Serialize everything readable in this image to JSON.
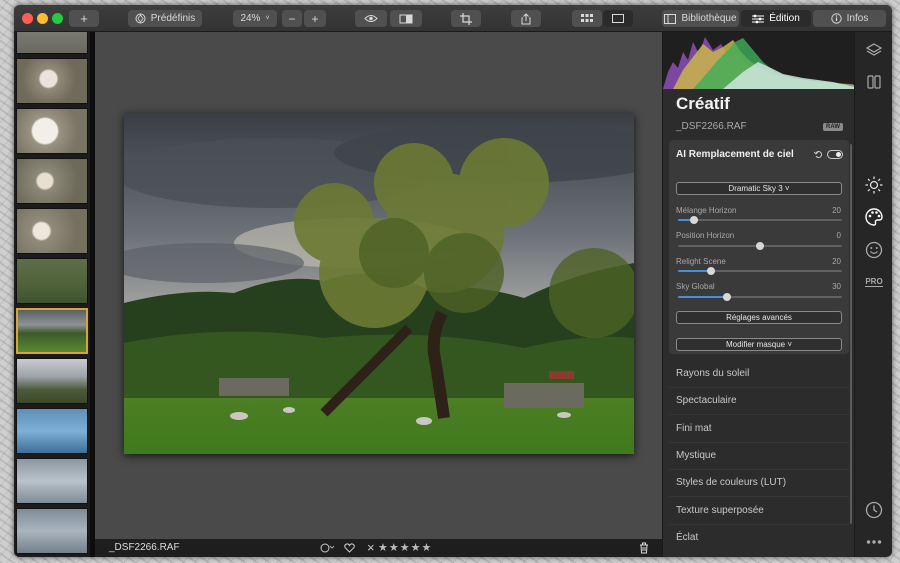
{
  "toolbar": {
    "add_label": "+",
    "presets_label": "Prédéfinis",
    "zoom_value": "24%",
    "zoom_minus": "−",
    "zoom_plus": "+",
    "library_label": "Bibliothèque",
    "edit_label": "Édition",
    "info_label": "Infos"
  },
  "panel": {
    "title": "Créatif",
    "filename": "_DSF2266.RAF",
    "raw_badge": "RAW",
    "card": {
      "title": "AI Remplacement de ciel",
      "sky_select": "Dramatic Sky 3 ˅",
      "sliders": [
        {
          "label": "Mélange Horizon",
          "value": "20",
          "fraction": 0.1
        },
        {
          "label": "Position Horizon",
          "value": "0",
          "fraction": 0.5
        },
        {
          "label": "Relight Scene",
          "value": "20",
          "fraction": 0.2
        },
        {
          "label": "Sky Global",
          "value": "30",
          "fraction": 0.3
        }
      ],
      "advanced_button": "Réglages avancés",
      "mask_button": "Modifier masque ˅"
    },
    "sections": [
      "Rayons du soleil",
      "Spectaculaire",
      "Fini mat",
      "Mystique",
      "Styles de couleurs (LUT)",
      "Texture superposée",
      "Éclat"
    ]
  },
  "bottombar": {
    "filename": "_DSF2266.RAF",
    "stars": "★★★★★",
    "reject": "×"
  },
  "colors": {
    "accent_blue": "#4a8fd6",
    "selection_gold": "#d7a43a",
    "traffic_red": "#fd5f57",
    "traffic_yellow": "#febc2e",
    "traffic_green": "#28c840"
  },
  "icons": {
    "right_column": [
      "layers-icon",
      "compare-icon",
      "sun-icon",
      "palette-icon",
      "smile-icon",
      "pro-icon",
      "clock-icon",
      "more-icon"
    ],
    "right_column_pro_label": "PRO"
  }
}
